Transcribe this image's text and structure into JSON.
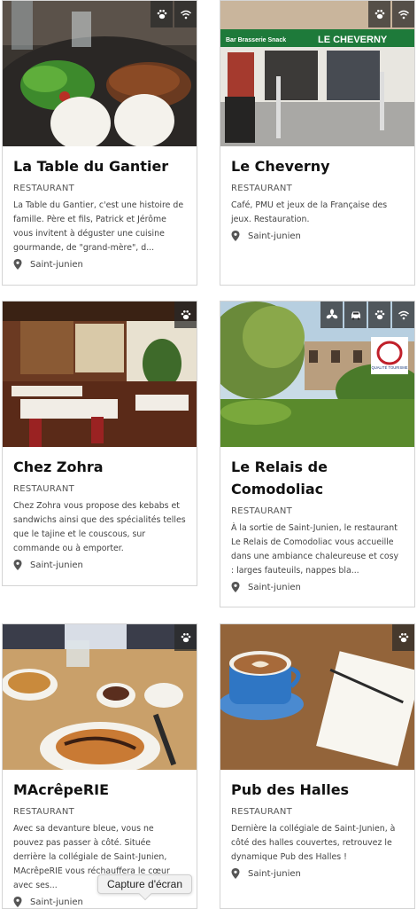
{
  "cards": [
    {
      "title": "La Table du Gantier",
      "category": "RESTAURANT",
      "description": "La Table du Gantier, c'est une histoire de famille. Père et fils, Patrick et Jérôme vous invitent à déguster une cuisine gourmande, de \"grand-mère\", d...",
      "location": "Saint-junien",
      "amenities": [
        "paw-icon",
        "wifi-icon"
      ]
    },
    {
      "title": "Le Cheverny",
      "category": "RESTAURANT",
      "description": "Café, PMU et jeux de la Française des jeux. Restauration.",
      "location": "Saint-junien",
      "amenities": [
        "paw-icon",
        "wifi-icon"
      ],
      "sign_text": "Bar Brasserie Snack",
      "sign_name": "LE CHEVERNY"
    },
    {
      "title": "Chez Zohra",
      "category": "RESTAURANT",
      "description": "Chez Zohra vous propose des kebabs et sandwichs ainsi que des spécialités telles que le tajine et le couscous, sur commande ou à emporter.",
      "location": "Saint-junien",
      "amenities": [
        "paw-icon"
      ]
    },
    {
      "title": "Le Relais de Comodoliac",
      "category": "RESTAURANT",
      "description": "À la sortie de Saint-Junien, le restaurant Le Relais de Comodoliac vous accueille dans une ambiance chaleureuse et cosy : larges fauteuils, nappes bla...",
      "location": "Saint-junien",
      "amenities": [
        "fan-icon",
        "car-icon",
        "paw-icon",
        "wifi-icon"
      ],
      "label_text": "QUALITÉ TOURISME"
    },
    {
      "title": "MAcrêpeRIE",
      "category": "RESTAURANT",
      "description": "Avec sa devanture bleue, vous ne pouvez pas passer à côté. Située derrière la collégiale de Saint-Junien, MAcrêpeRIE vous réchauffera le cœur avec ses...",
      "location": "Saint-junien",
      "amenities": [
        "paw-icon"
      ]
    },
    {
      "title": "Pub des Halles",
      "category": "RESTAURANT",
      "description": "Dernière la collégiale de Saint-Junien, à côté des halles couvertes, retrouvez le dynamique Pub des Halles !",
      "location": "Saint-junien",
      "amenities": [
        "paw-icon"
      ]
    }
  ],
  "tooltip": "Capture d'écran",
  "colors": {
    "badge_bg": "#2a2a2a",
    "border": "#d4d4d4",
    "title": "#111111",
    "text": "#444444"
  }
}
